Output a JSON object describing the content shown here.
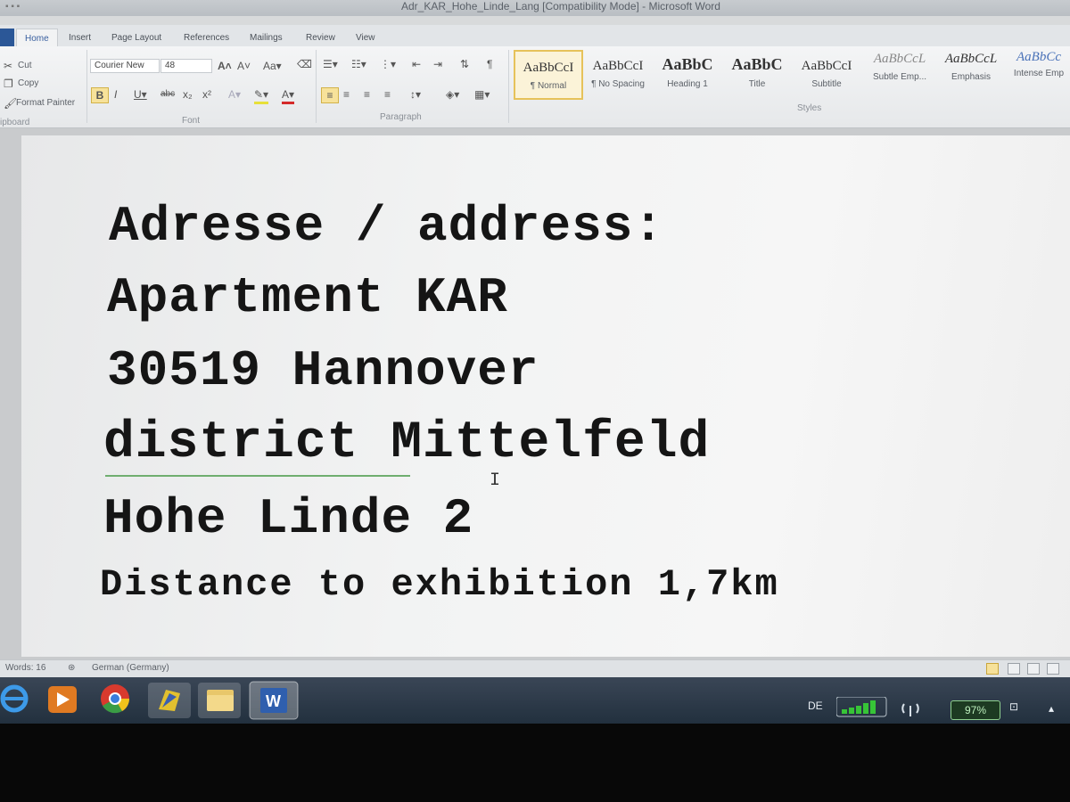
{
  "window": {
    "title": "Adr_KAR_Hohe_Linde_Lang [Compatibility Mode] - Microsoft Word"
  },
  "tabs": [
    {
      "label": "Home",
      "active": true
    },
    {
      "label": "Insert"
    },
    {
      "label": "Page Layout"
    },
    {
      "label": "References"
    },
    {
      "label": "Mailings"
    },
    {
      "label": "Review"
    },
    {
      "label": "View"
    }
  ],
  "clipboard": {
    "cut": "Cut",
    "copy": "Copy",
    "format_painter": "Format Painter",
    "group_label": "ipboard"
  },
  "font": {
    "name": "Courier New",
    "size": "48",
    "group_label": "Font"
  },
  "paragraph": {
    "group_label": "Paragraph"
  },
  "styles": {
    "group_label": "Styles",
    "items": [
      {
        "sample": "AaBbCcI",
        "name": "¶ Normal",
        "selected": true
      },
      {
        "sample": "AaBbCcI",
        "name": "¶ No Spacing"
      },
      {
        "sample": "AaBbC",
        "name": "Heading 1"
      },
      {
        "sample": "AaBbC",
        "name": "Title"
      },
      {
        "sample": "AaBbCcI",
        "name": "Subtitle"
      },
      {
        "sample": "AaBbCcL",
        "name": "Subtle Emp..."
      },
      {
        "sample": "AaBbCcL",
        "name": "Emphasis"
      },
      {
        "sample": "AaBbCc",
        "name": "Intense Emp"
      }
    ]
  },
  "document": {
    "lines": [
      "Adresse / address:",
      "Apartment KAR",
      "30519 Hannover",
      "district Mittelfeld",
      "Hohe Linde 2",
      "Distance to exhibition 1,7km"
    ]
  },
  "status": {
    "words": "Words: 16",
    "language": "German (Germany)"
  },
  "tray": {
    "lang": "DE",
    "battery": "97%"
  },
  "icons": {
    "ie": "internet-explorer-icon",
    "media": "media-player-icon",
    "chrome": "chrome-icon",
    "app": "app-icon",
    "folder": "file-explorer-icon",
    "word": "word-icon"
  }
}
